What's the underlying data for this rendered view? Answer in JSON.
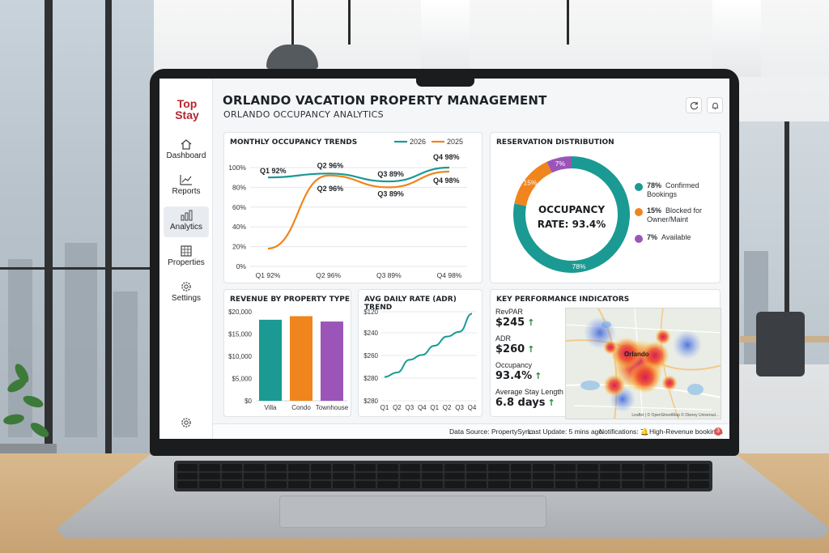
{
  "app": {
    "logo_text": "Top Stay",
    "title": "ORLANDO VACATION PROPERTY MANAGEMENT",
    "subtitle": "ORLANDO OCCUPANCY ANALYTICS"
  },
  "sidebar": {
    "items": [
      {
        "label": "Dashboard",
        "icon": "home-icon"
      },
      {
        "label": "Reports",
        "icon": "line-chart-icon"
      },
      {
        "label": "Analytics",
        "icon": "bar-chart-icon",
        "active": true
      },
      {
        "label": "Properties",
        "icon": "building-icon"
      },
      {
        "label": "Settings",
        "icon": "gear-icon"
      }
    ],
    "bottom_icon": "gear-icon"
  },
  "header": {
    "buttons": [
      {
        "icon": "refresh-icon"
      },
      {
        "icon": "bell-icon"
      }
    ]
  },
  "colors": {
    "teal": "#1a9a93",
    "orange": "#f0851e",
    "purple": "#9b55b8",
    "green_up": "#1f8a3b",
    "brand_red": "#b7262f"
  },
  "occupancy_trends": {
    "title": "MONTHLY OCCUPANCY TRENDS",
    "labels": {
      "q1_2026": "Q1 92%",
      "q2_2026": "Q2 96%",
      "q2_2025": "Q2 96%",
      "q3_2026": "Q3 89%",
      "q3_2025": "Q3 89%",
      "q4_2026": "Q4 98%",
      "q4_2025": "Q4 98%"
    }
  },
  "reservation_distribution": {
    "title": "RESERVATION DISTRIBUTION",
    "center_line1": "OCCUPANCY",
    "center_line2": "RATE: 93.4%",
    "slice_labels": [
      "78%",
      "15%",
      "7%"
    ],
    "legend": [
      {
        "pct": "78%",
        "text1": "Confirmed",
        "text2": "Bookings"
      },
      {
        "pct": "15%",
        "text1": "Blocked for",
        "text2": "Owner/Maint"
      },
      {
        "pct": "7%",
        "text1": "Available",
        "text2": ""
      }
    ]
  },
  "revenue_by_type": {
    "title": "REVENUE BY PROPERTY TYPE"
  },
  "adr_trend": {
    "title": "AVG DAILY RATE (ADR) TREND"
  },
  "kpis": {
    "title": "KEY PERFORMANCE INDICATORS",
    "items": [
      {
        "label": "RevPAR",
        "value": "$245"
      },
      {
        "label": "ADR",
        "value": "$260"
      },
      {
        "label": "Occupancy",
        "value": "93.4%"
      },
      {
        "label": "Average Stay Length",
        "value": "6.8 days"
      }
    ],
    "map": {
      "city_label": "Orlando",
      "attribution": "Leaflet | © OpenStreetMap © Disney Universal..."
    }
  },
  "footer": {
    "data_source": "Data Source: PropertySync",
    "last_update": "Last Update: 5 mins ago",
    "notifications": "Notifications: 7",
    "alert_text": "High-Revenue bookings",
    "badge": "3"
  },
  "chart_data": [
    {
      "type": "line",
      "title": "MONTHLY OCCUPANCY TRENDS",
      "categories": [
        "Q1 92%",
        "Q2 96%",
        "Q3 89%",
        "Q4 98%"
      ],
      "ylim": [
        0,
        100
      ],
      "yticks": [
        "0%",
        "20%",
        "40%",
        "60%",
        "80%",
        "100%"
      ],
      "legend_position": "top-right",
      "series": [
        {
          "name": "2026",
          "color": "#1a9a93",
          "values": [
            90,
            94,
            86,
            100
          ]
        },
        {
          "name": "2025",
          "color": "#f0851e",
          "values": [
            18,
            92,
            80,
            96
          ]
        }
      ]
    },
    {
      "type": "pie",
      "title": "RESERVATION DISTRIBUTION",
      "slices": [
        {
          "label": "Confirmed Bookings",
          "value": 78,
          "color": "#1a9a93"
        },
        {
          "label": "Blocked for Owner/Maint",
          "value": 15,
          "color": "#f0851e"
        },
        {
          "label": "Available",
          "value": 7,
          "color": "#9b55b8"
        }
      ]
    },
    {
      "type": "bar",
      "title": "REVENUE BY PROPERTY TYPE",
      "categories": [
        "Villa",
        "Condo",
        "Townhouse"
      ],
      "values": [
        18200,
        19000,
        17800
      ],
      "colors": [
        "#1a9a93",
        "#f0851e",
        "#9b55b8"
      ],
      "ylim": [
        0,
        20000
      ],
      "yticks": [
        "$0",
        "$5,000",
        "$10,000",
        "$15,000",
        "$20,000"
      ]
    },
    {
      "type": "line",
      "title": "AVG DAILY RATE (ADR) TREND",
      "categories": [
        "Q1",
        "Q2",
        "Q3",
        "Q4",
        "Q1",
        "Q2",
        "Q3",
        "Q4"
      ],
      "ylim": [
        120,
        280
      ],
      "yticks": [
        "$120",
        "$240",
        "$260",
        "$280",
        "$280"
      ],
      "series": [
        {
          "name": "ADR",
          "color": "#1a9a93",
          "values": [
            127,
            138,
            170,
            182,
            205,
            228,
            240,
            285
          ]
        }
      ]
    }
  ]
}
